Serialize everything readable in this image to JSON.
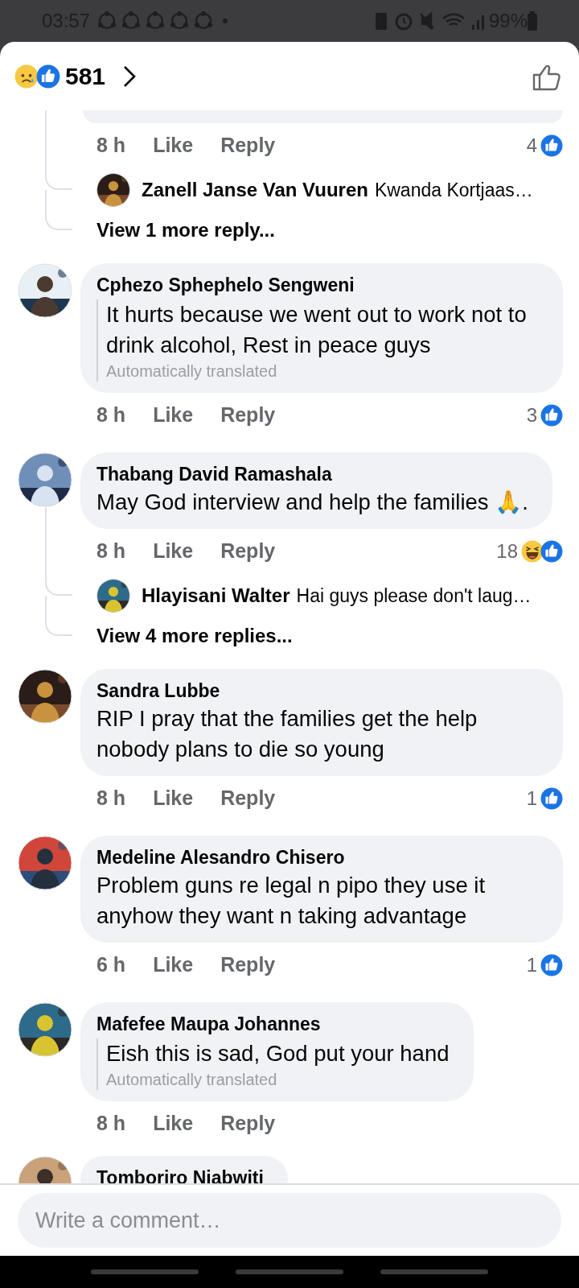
{
  "status_bar": {
    "time": "03:57",
    "battery": "99%"
  },
  "header": {
    "reactions": [
      {
        "kind": "sad"
      },
      {
        "kind": "like"
      }
    ],
    "count": "581"
  },
  "comments": [
    {
      "kind": "cut_top",
      "time": "8 h",
      "like": "Like",
      "reply": "Reply",
      "reaction_count": "4",
      "reactions": [
        {
          "kind": "like"
        }
      ],
      "replies": [
        {
          "author": "Zanell Janse Van Vuuren",
          "text": "Kwanda Kortjaas…"
        }
      ],
      "more_replies": "View 1 more reply..."
    },
    {
      "kind": "full",
      "author": "Cphezo Sphephelo Sengweni",
      "text": "It hurts because we went out to work not to drink alcohol, Rest in peace guys",
      "translation_note": "Automatically translated",
      "time": "8 h",
      "like": "Like",
      "reply": "Reply",
      "reaction_count": "3",
      "reactions": [
        {
          "kind": "like"
        }
      ]
    },
    {
      "kind": "full",
      "author": "Thabang David Ramashala",
      "text": "May God interview and help the families 🙏.",
      "time": "8 h",
      "like": "Like",
      "reply": "Reply",
      "reaction_count": "18",
      "reactions": [
        {
          "kind": "haha"
        },
        {
          "kind": "like"
        }
      ],
      "replies": [
        {
          "author": "Hlayisani Walter",
          "text": "Hai guys please don't laug…"
        }
      ],
      "more_replies": "View 4 more replies..."
    },
    {
      "kind": "full",
      "author": "Sandra Lubbe",
      "text": "RIP I pray that the families get the help nobody plans to die so young",
      "time": "8 h",
      "like": "Like",
      "reply": "Reply",
      "reaction_count": "1",
      "reactions": [
        {
          "kind": "like"
        }
      ]
    },
    {
      "kind": "full",
      "author": "Medeline Alesandro Chisero",
      "text": "Problem guns re legal n pipo they use it anyhow they want n taking advantage",
      "time": "6 h",
      "like": "Like",
      "reply": "Reply",
      "reaction_count": "1",
      "reactions": [
        {
          "kind": "like"
        }
      ]
    },
    {
      "kind": "full",
      "author": "Mafefee Maupa Johannes",
      "text": "Eish this is sad, God put your hand",
      "translation_note": "Automatically translated",
      "time": "8 h",
      "like": "Like",
      "reply": "Reply"
    },
    {
      "kind": "cut_bottom",
      "author": "Tomboriro Niabwiti"
    }
  ],
  "composer": {
    "placeholder": "Write a comment…"
  }
}
